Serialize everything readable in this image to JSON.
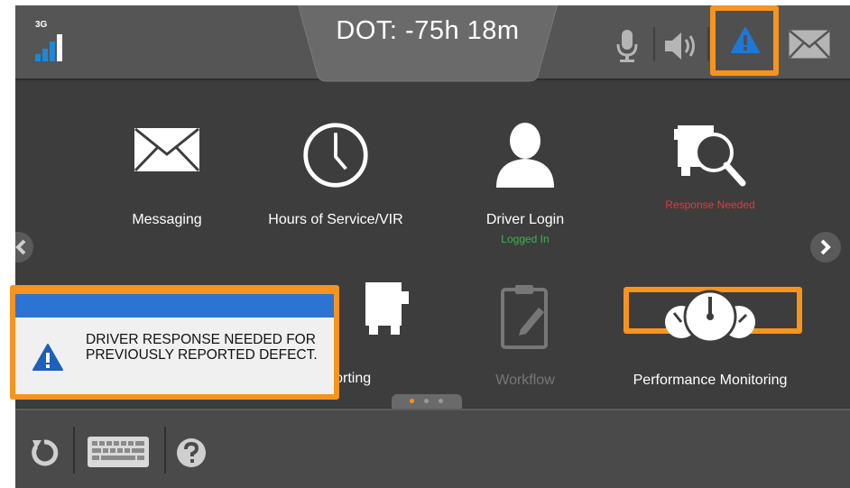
{
  "status_bar": {
    "network_label": "3G",
    "dot_label": "DOT: -75h 18m"
  },
  "apps": [
    {
      "label": "Messaging",
      "sub": "",
      "icon": "envelope-icon"
    },
    {
      "label": "Hours of Service/VIR",
      "sub": "",
      "icon": "clock-icon"
    },
    {
      "label": "Driver Login",
      "sub": "Logged In",
      "icon": "user-icon"
    },
    {
      "label": "",
      "sub": "Response Needed",
      "icon": "truck-search-icon"
    },
    {
      "label": "",
      "sub": "",
      "icon": "clipboard-icon"
    },
    {
      "label": "t Reporting",
      "sub": "",
      "icon": "truck-icon"
    },
    {
      "label": "Workflow",
      "sub": "",
      "icon": "clipboard-edit-icon"
    },
    {
      "label": "Performance Monitoring",
      "sub": "",
      "icon": "gauges-icon"
    }
  ],
  "notification": {
    "message": "DRIVER RESPONSE NEEDED FOR PREVIOUSLY REPORTED DEFECT.",
    "icon": "warning-icon"
  },
  "pagination": {
    "current": 1,
    "total": 3
  },
  "colors": {
    "highlight": "#f7941d",
    "accent_blue": "#1e88d8",
    "status_green": "#3cb44b",
    "status_red": "#e53935",
    "disabled_text": "#777777"
  }
}
